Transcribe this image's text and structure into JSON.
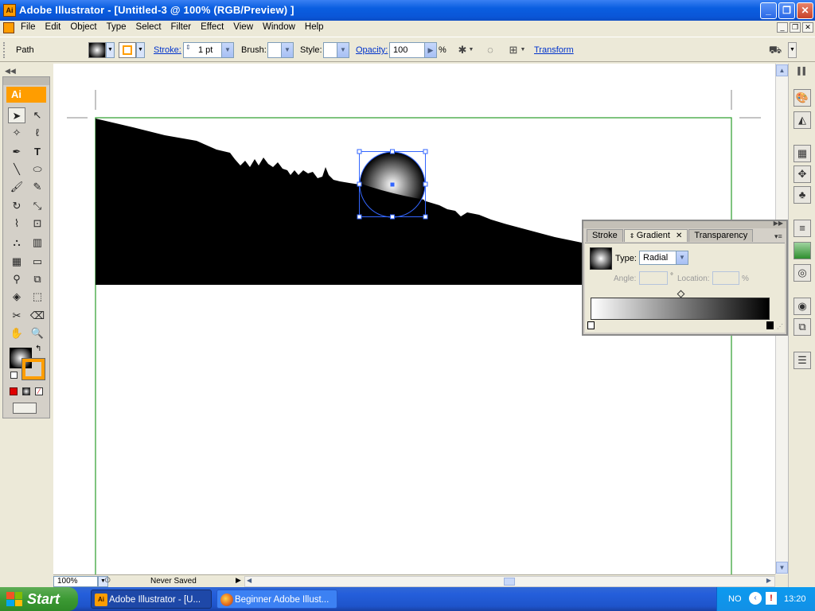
{
  "window": {
    "title": "Adobe Illustrator - [Untitled-3 @ 100% (RGB/Preview) ]",
    "app_icon": "Ai",
    "buttons": [
      "minimize-icon",
      "restore-icon",
      "close-icon"
    ]
  },
  "menubar": {
    "items": [
      "File",
      "Edit",
      "Object",
      "Type",
      "Select",
      "Filter",
      "Effect",
      "View",
      "Window",
      "Help"
    ]
  },
  "control": {
    "selection_label": "Path",
    "stroke_label": "Stroke:",
    "stroke_value": "1 pt",
    "brush_label": "Brush:",
    "style_label": "Style:",
    "opacity_label": "Opacity:",
    "opacity_value": "100",
    "percent": "%",
    "transform_link": "Transform",
    "stroke_color": "#ff9d00"
  },
  "tools": {
    "logo": "Ai",
    "fill_swatch": "radial-gradient",
    "stroke_color": "#ff9d00"
  },
  "gradient_panel": {
    "tabs": [
      "Stroke",
      "Gradient",
      "Transparency"
    ],
    "active_tab": "Gradient",
    "type_label": "Type:",
    "type_value": "Radial",
    "angle_label": "Angle:",
    "location_label": "Location:",
    "degree": "°",
    "percent": "%",
    "gradient_start": "#ffffff",
    "gradient_end": "#000000"
  },
  "status": {
    "zoom": "100%",
    "save_state": "Never Saved"
  },
  "taskbar": {
    "start_label": "Start",
    "tasks": [
      {
        "label": "Adobe Illustrator - [U...",
        "active": true
      },
      {
        "label": "Beginner Adobe Illust...",
        "active": false
      }
    ],
    "lang": "NO",
    "clock": "13:20"
  },
  "colors": {
    "xp_blue": "#0a56d8",
    "artboard_border": "#2a9d2a",
    "selection_blue": "#3366ff",
    "orange": "#ff9d00"
  }
}
